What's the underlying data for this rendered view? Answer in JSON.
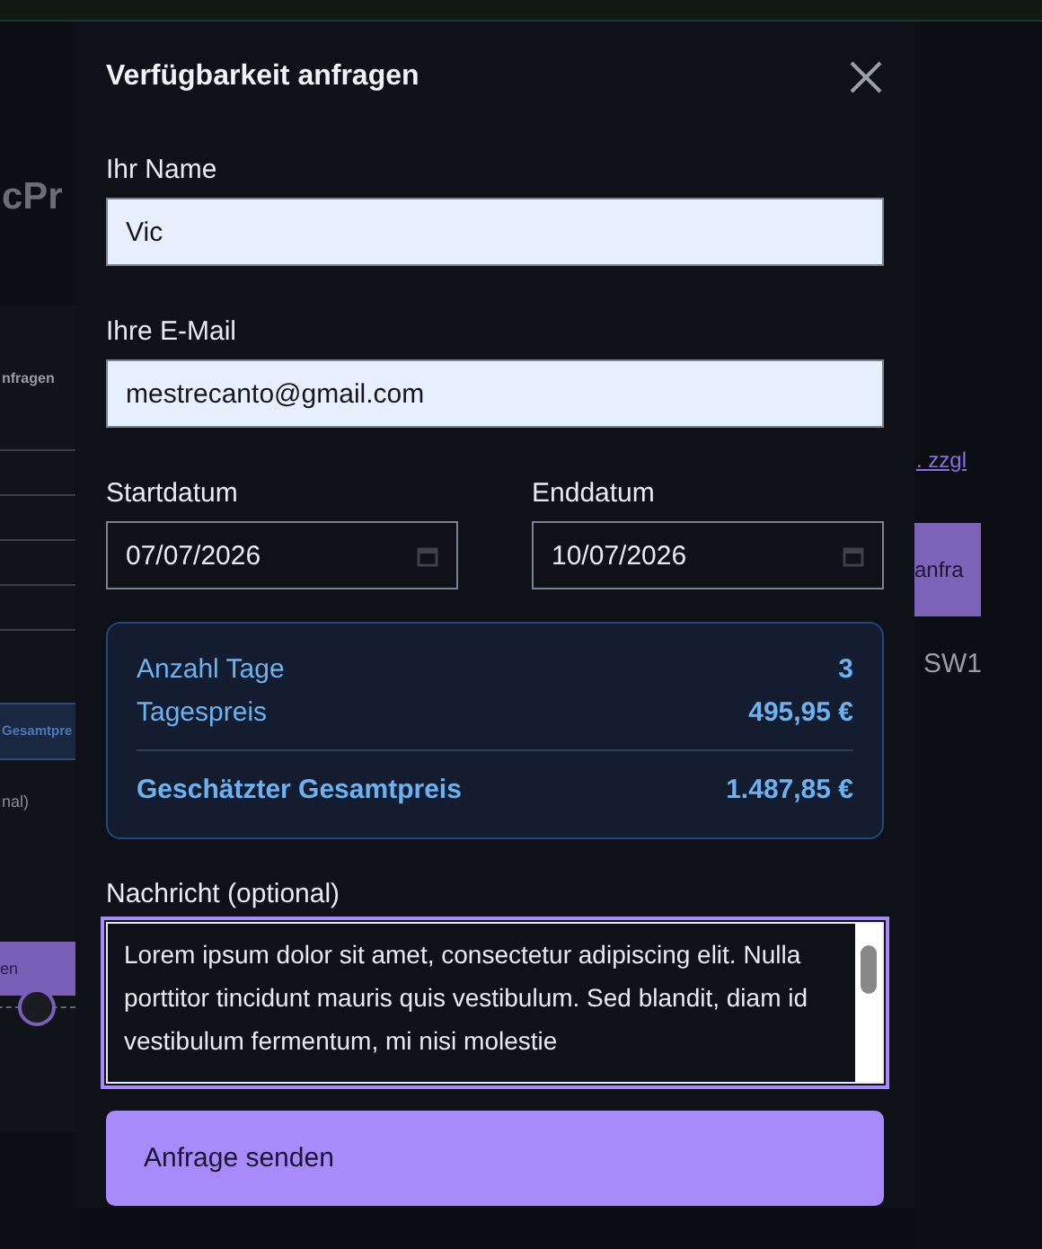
{
  "background": {
    "title_fragment": "cPr",
    "card_heading_fragment": "nfragen",
    "card_total_fragment": "Gesamtpre",
    "card_message_fragment": "nal)",
    "card_button_fragment": "en",
    "link_fragment": ". zzgl",
    "button_fragment": "anfra",
    "code_fragment": "SW1"
  },
  "dialog": {
    "title": "Verfügbarkeit anfragen",
    "fields": [
      {
        "label": "Ihr Name",
        "value": "Vic"
      },
      {
        "label": "Ihre E-Mail",
        "value": "mestrecanto@gmail.com"
      }
    ],
    "dates": [
      {
        "label": "Startdatum",
        "value": "07/07/2026"
      },
      {
        "label": "Enddatum",
        "value": "10/07/2026"
      }
    ],
    "summary": {
      "rows": [
        {
          "label": "Anzahl Tage",
          "value": "3"
        },
        {
          "label": "Tagespreis",
          "value": "495,95 €"
        }
      ],
      "total": {
        "label": "Geschätzter Gesamtpreis",
        "value": "1.487,85 €"
      }
    },
    "message": {
      "label": "Nachricht (optional)",
      "value": "Lorem ipsum dolor sit amet, consectetur adipiscing elit. Nulla porttitor tincidunt mauris quis vestibulum. Sed blandit, diam id vestibulum fermentum, mi nisi molestie",
      "focused": true
    },
    "submit": "Anfrage senden"
  }
}
